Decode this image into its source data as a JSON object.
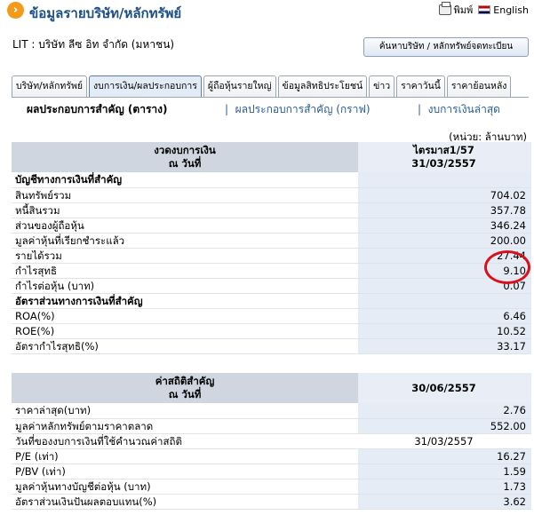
{
  "header": {
    "icon_symbol": "›",
    "title": "ข้อมูลรายบริษัท/หลักทรัพย์",
    "print_label": "พิมพ์",
    "english_label": "English"
  },
  "company": {
    "name": "LIT : บริษัท ลีซ อิท จำกัด (มหาชน)",
    "search_button": "ค้นหาบริษัท / หลักทรัพย์จดทะเบียน"
  },
  "tabs": [
    "บริษัท/หลักทรัพย์",
    "งบการเงิน/ผลประกอบการ",
    "ผู้ถือหุ้นรายใหญ่",
    "ข้อมูลสิทธิประโยชน์",
    "ข่าว",
    "ราคาวันนี้",
    "ราคาย้อนหลัง"
  ],
  "active_tab_index": 1,
  "subnav": {
    "current": "ผลประกอบการสำคัญ (ตาราง)",
    "graph": "ผลประกอบการสำคัญ (กราฟ)",
    "latest": "งบการเงินล่าสุด"
  },
  "unit": "(หน่วย: ล้านบาท)",
  "financials": {
    "head_label_1": "งวดงบการเงิน",
    "head_label_2": "ณ วันที่",
    "period_1": "ไตรมาส1/57",
    "period_2": "31/03/2557",
    "section_1": "บัญชีทางการเงินที่สำคัญ",
    "rows_1": [
      {
        "label": "สินทรัพย์รวม",
        "value": "704.02"
      },
      {
        "label": "หนี้สินรวม",
        "value": "357.78"
      },
      {
        "label": "ส่วนของผู้ถือหุ้น",
        "value": "346.24"
      },
      {
        "label": "มูลค่าหุ้นที่เรียกชำระแล้ว",
        "value": "200.00"
      },
      {
        "label": "รายได้รวม",
        "value": "27.44"
      },
      {
        "label": "กำไรสุทธิ",
        "value": "9.10"
      },
      {
        "label": "กำไรต่อหุ้น (บาท)",
        "value": "0.07"
      }
    ],
    "section_2": "อัตราส่วนทางการเงินที่สำคัญ",
    "rows_2": [
      {
        "label": "ROA(%)",
        "value": "6.46"
      },
      {
        "label": "ROE(%)",
        "value": "10.52"
      },
      {
        "label": "อัตรากำไรสุทธิ(%)",
        "value": "33.17"
      }
    ]
  },
  "stats": {
    "head_label_1": "ค่าสถิติสำคัญ",
    "head_label_2": "ณ วันที่",
    "date": "30/06/2557",
    "rows": [
      {
        "label": "ราคาล่าสุด(บาท)",
        "value": "2.76"
      },
      {
        "label": "มูลค่าหลักทรัพย์ตามราคาตลาด",
        "value": "552.00"
      },
      {
        "label": "วันที่ของงบการเงินที่ใช้คำนวณค่าสถิติ",
        "value": "31/03/2557"
      },
      {
        "label": "P/E (เท่า)",
        "value": "16.27"
      },
      {
        "label": "P/BV (เท่า)",
        "value": "1.59"
      },
      {
        "label": "มูลค่าหุ้นทางบัญชีต่อหุ้น (บาท)",
        "value": "1.73"
      },
      {
        "label": "อัตราส่วนเงินปันผลตอบแทน(%)",
        "value": "3.62"
      }
    ]
  },
  "colors": {
    "annotation_circle": "#d8101a",
    "title_blue": "#1c4f86",
    "value_column": "#e5ecf6"
  }
}
